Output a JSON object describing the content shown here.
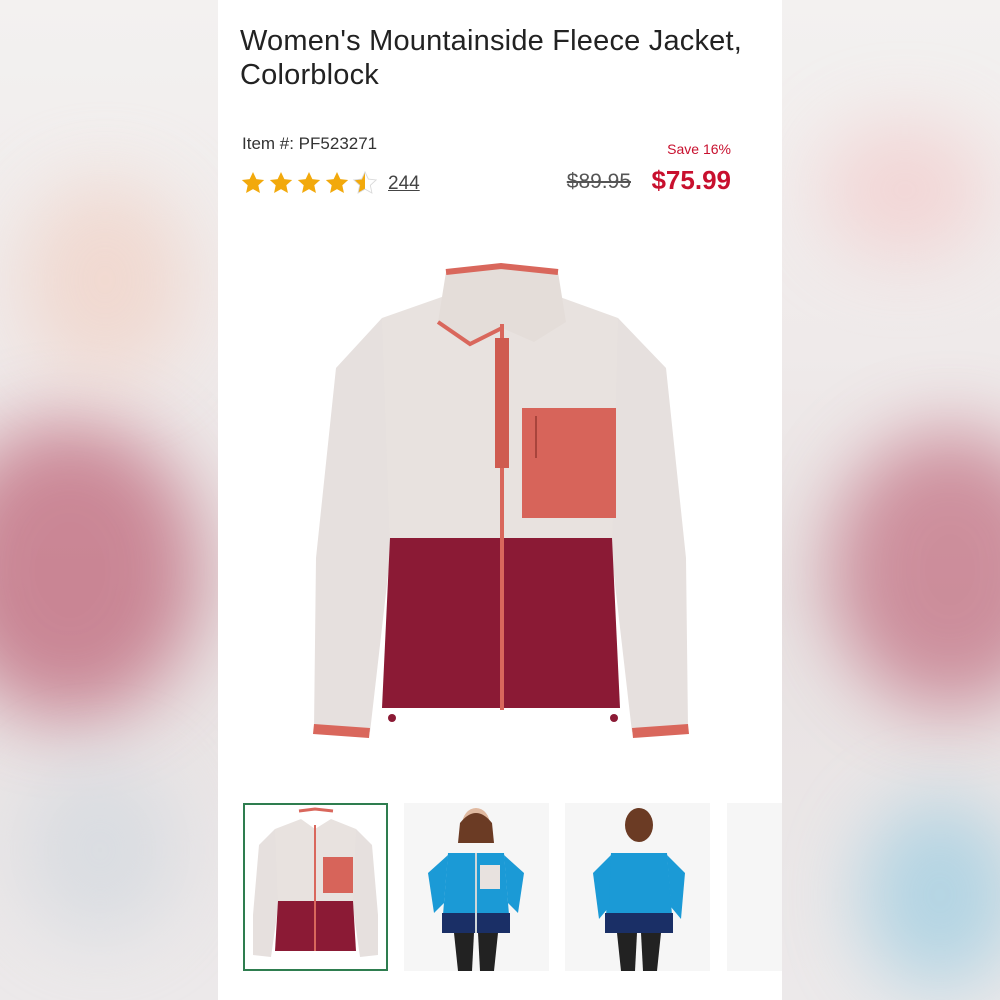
{
  "product": {
    "title": "Women's Mountainside Fleece Jacket, Colorblock",
    "item_number": "Item #: PF523271",
    "rating": 4.5,
    "review_count": "244",
    "save_text": "Save 16%",
    "original_price": "$89.95",
    "sale_price": "$75.99"
  },
  "colors": {
    "sale_red": "#c8102e",
    "star_gold": "#f2a90c",
    "selected_border": "#2e7d4f"
  },
  "thumbnails": [
    {
      "name": "jacket flat lay",
      "selected": true
    },
    {
      "name": "model front view",
      "selected": false
    },
    {
      "name": "model back view",
      "selected": false
    }
  ]
}
